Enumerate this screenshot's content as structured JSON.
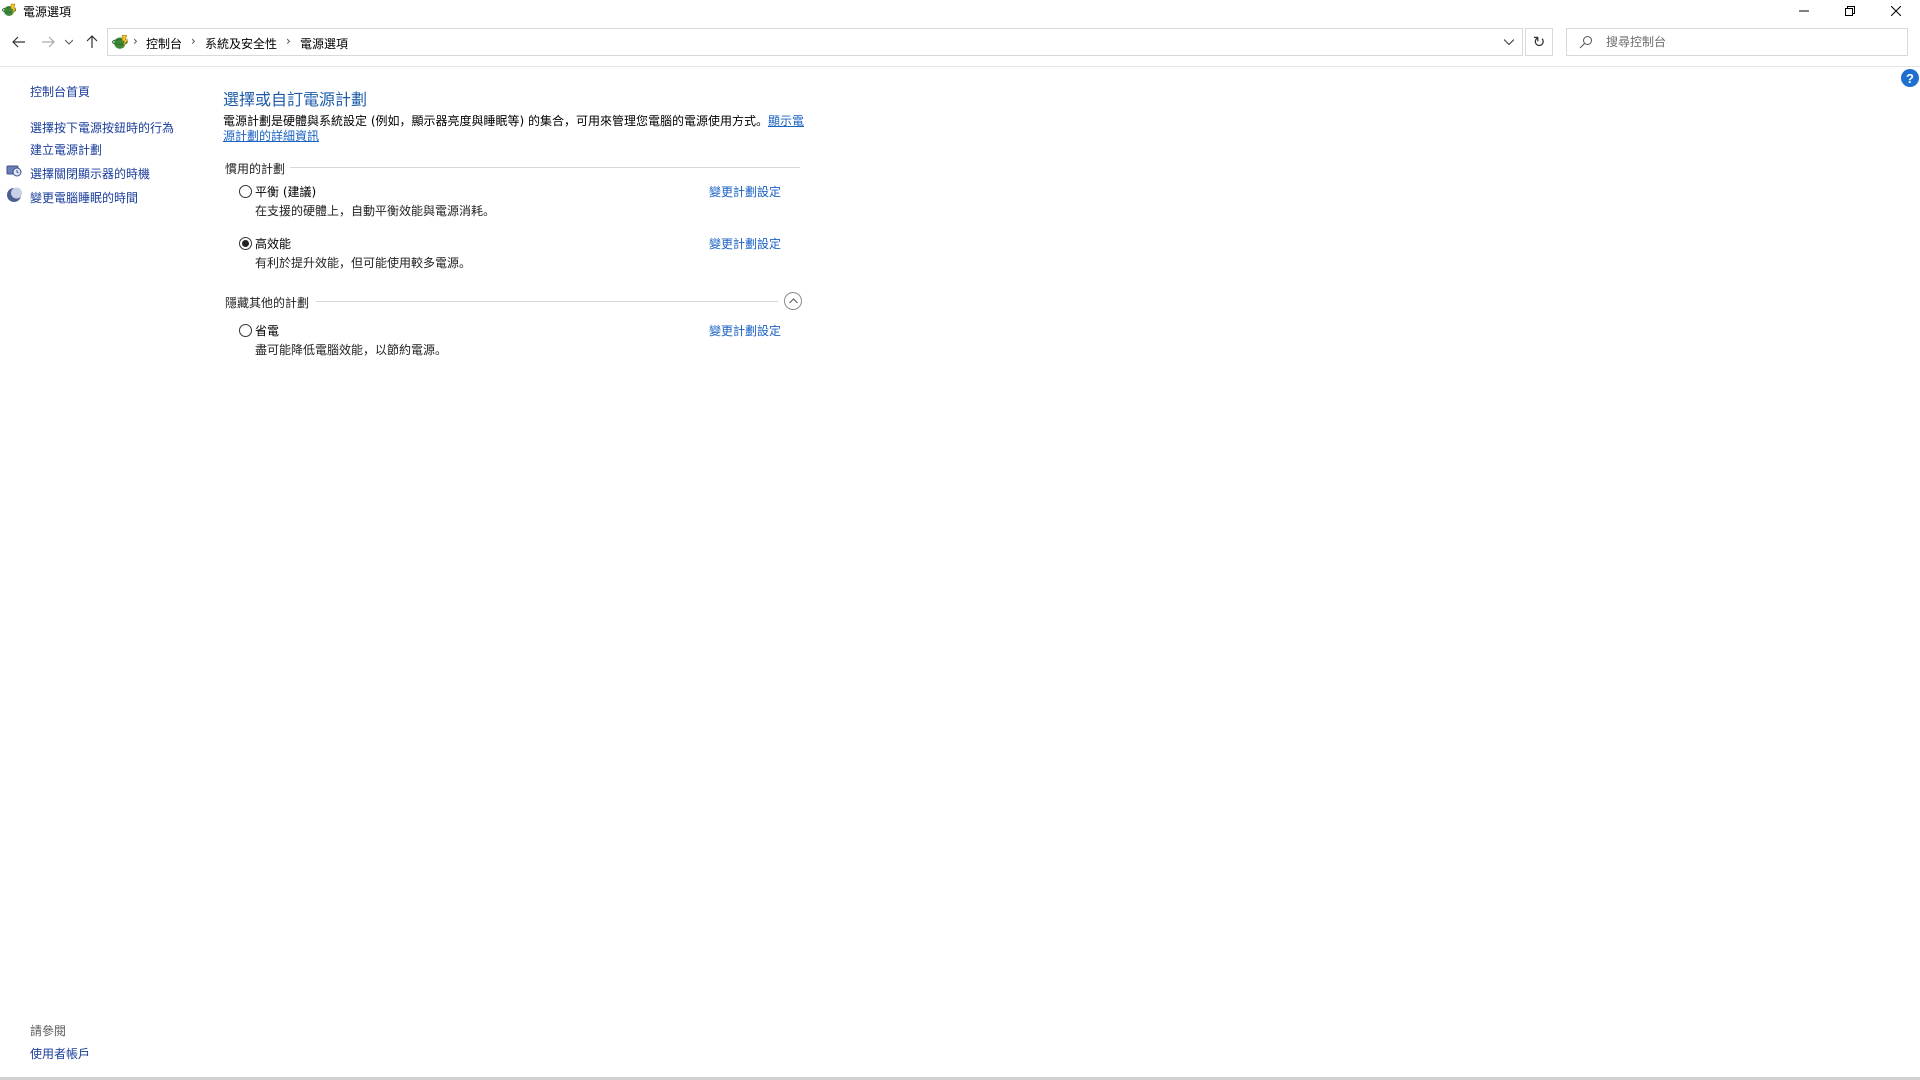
{
  "window": {
    "title": "電源選項"
  },
  "address": {
    "crumbs": [
      "控制台",
      "系統及安全性",
      "電源選項"
    ]
  },
  "search": {
    "placeholder": "搜尋控制台"
  },
  "sidebar": {
    "home": "控制台首頁",
    "items": [
      {
        "label": "選擇按下電源按鈕時的行為",
        "icon": ""
      },
      {
        "label": "建立電源計劃",
        "icon": ""
      },
      {
        "label": "選擇關閉顯示器的時機",
        "icon": "monitor-clock-icon"
      },
      {
        "label": "變更電腦睡眠的時間",
        "icon": "moon-icon"
      }
    ],
    "see_also": "請參閱",
    "see_also_link": "使用者帳戶"
  },
  "main": {
    "title": "選擇或自訂電源計劃",
    "description": "電源計劃是硬體與系統設定 (例如，顯示器亮度與睡眠等) 的集合，可用來管理您電腦的電源使用方式。",
    "description_link": "顯示電源計劃的詳細資訊",
    "preferred_heading": "慣用的計劃",
    "hidden_heading": "隱藏其他的計劃",
    "plans": [
      {
        "name": "平衡 (建議)",
        "description": "在支援的硬體上，自動平衡效能與電源消耗。",
        "link": "變更計劃設定",
        "selected": false
      },
      {
        "name": "高效能",
        "description": "有利於提升效能，但可能使用較多電源。",
        "link": "變更計劃設定",
        "selected": true
      }
    ],
    "hidden_plans": [
      {
        "name": "省電",
        "description": "盡可能降低電腦效能，以節約電源。",
        "link": "變更計劃設定",
        "selected": false
      }
    ]
  },
  "colors": {
    "link": "#1a62c3",
    "title": "#1e5ba8",
    "help": "#1e6fd0"
  }
}
